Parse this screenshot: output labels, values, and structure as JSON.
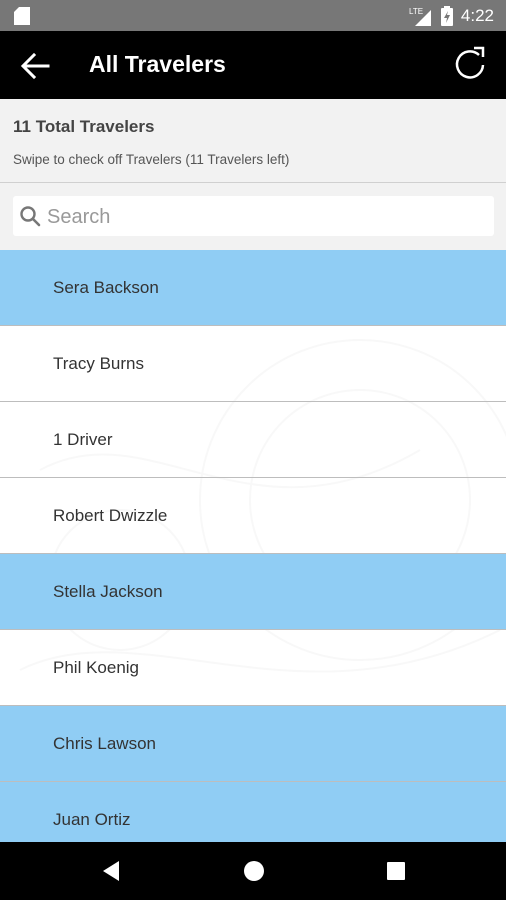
{
  "status_bar": {
    "time": "4:22",
    "network_label": "LTE",
    "icons": [
      "sd-card-icon",
      "lte-signal-icon",
      "battery-icon"
    ]
  },
  "app_bar": {
    "title": "All Travelers",
    "back_icon": "arrow-left-icon",
    "refresh_icon": "refresh-icon"
  },
  "summary": {
    "total_label": "11 Total Travelers",
    "hint": "Swipe to check off Travelers (11 Travelers left)"
  },
  "search": {
    "placeholder": "Search",
    "value": ""
  },
  "colors": {
    "highlight": "#90cdf4",
    "normal": "#ffffff"
  },
  "travelers": [
    {
      "name": "Sera Backson",
      "highlighted": true
    },
    {
      "name": "Tracy Burns",
      "highlighted": false
    },
    {
      "name": "1 Driver",
      "highlighted": false
    },
    {
      "name": "Robert Dwizzle",
      "highlighted": false
    },
    {
      "name": "Stella Jackson",
      "highlighted": true
    },
    {
      "name": "Phil Koenig",
      "highlighted": false
    },
    {
      "name": "Chris Lawson",
      "highlighted": true
    },
    {
      "name": "Juan Ortiz",
      "highlighted": true
    }
  ],
  "nav_bar": {
    "icons": [
      "back-triangle-icon",
      "home-circle-icon",
      "recents-square-icon"
    ]
  }
}
